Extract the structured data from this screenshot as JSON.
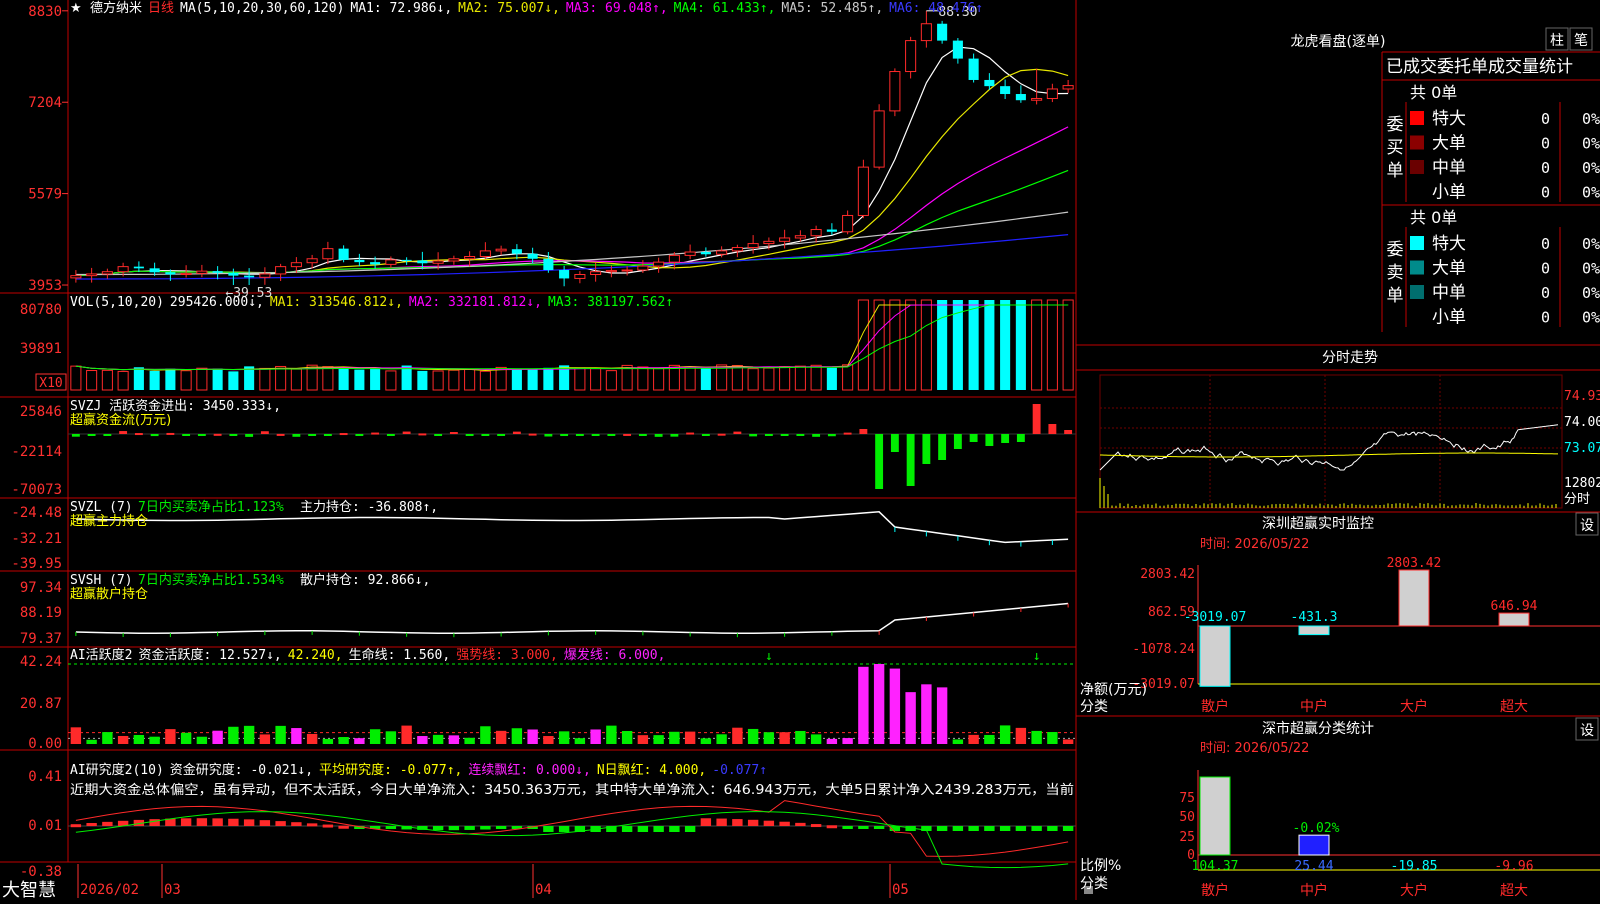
{
  "colors": {
    "up": "#ff2a2a",
    "down": "#00ffff",
    "ma1": "#ffffff",
    "ma2": "#e8e800",
    "ma3": "#ff00ff",
    "ma4": "#00ff00",
    "ma5": "#c8c8c8",
    "ma6": "#2020ff",
    "grid": "#c00000",
    "axis": "#ff3030",
    "green": "#00ee00",
    "magenta": "#ff22ff",
    "yellow": "#ffff00",
    "cyan": "#00ffff",
    "white": "#ffffff",
    "panelTitle": "#e0e0e0"
  },
  "header": {
    "stock": "德方纳米",
    "period": "日线",
    "ma_label": "MA(5,10,20,30,60,120)",
    "ma1": "MA1: 72.986↓,",
    "ma2": "MA2: 75.007↓,",
    "ma3": "MA3: 69.048↑,",
    "ma4": "MA4: 61.433↑,",
    "ma5": "MA5: 52.485↑,",
    "ma6": "MA6: 48.476↑"
  },
  "price_axis": [
    "8830",
    "7204",
    "5579",
    "3953"
  ],
  "price_annotations": {
    "high": "88.30",
    "low": "←39.53"
  },
  "vol": {
    "title": "VOL(5,10,20)",
    "vol": "295426.000↓,",
    "ma1": "MA1: 313546.812↓,",
    "ma2": "MA2: 332181.812↓,",
    "ma3": "MA3: 381197.562↑",
    "axis": [
      "80780",
      "39891"
    ],
    "unit": "X10"
  },
  "svzj": {
    "title": "SVZJ  活跃资金进出: 3450.333↓,",
    "subtitle": "超赢资金流(万元)",
    "axis": [
      "25846",
      "-22114",
      "-70073"
    ]
  },
  "svzl": {
    "title": "SVZL (7)",
    "t2": "7日内买卖净占比1.123%",
    "t3": "主力持仓: -36.808↑,",
    "subtitle": "超赢主力持仓",
    "axis": [
      "-24.48",
      "-32.21",
      "-39.95"
    ]
  },
  "svsh": {
    "title": "SVSH (7)",
    "t2": "7日内买卖净占比1.534%",
    "t3": "散户持仓: 92.866↓,",
    "subtitle": "超赢散户持仓",
    "axis": [
      "97.34",
      "88.19",
      "79.37"
    ]
  },
  "ai1": {
    "t1": "AI活跃度2",
    "t2": "资金活跃度: 12.527↓,",
    "t3": "42.240,",
    "t4": "生命线: 1.560,",
    "t5": "强势线: 3.000,",
    "t6": "爆发线: 6.000,",
    "axis": [
      "42.24",
      "20.87",
      "0.00"
    ]
  },
  "ai2": {
    "t1": "AI研究度2(10)",
    "t2": "资金研究度: -0.021↓,",
    "t3": "平均研究度: -0.077↑,",
    "t4": "连续飘红: 0.000↓,",
    "t5": "N日飘红: 4.000,",
    "t6": "-0.077↑",
    "desc": "近期大资金总体偏空，虽有异动，但不太活跃，今日大单净流入：3450.363万元，其中特大单净流入：646.943万元，大单5日累计净入2439.283万元，当前",
    "axis": [
      "0.41",
      "0.01",
      "-0.38"
    ]
  },
  "bottom": {
    "brand": "大智慧",
    "d1": "2026/02",
    "d2": "03",
    "d3": "04",
    "d4": "05"
  },
  "lhb": {
    "title": "龙虎看盘(逐单)",
    "btn1": "柱",
    "btn2": "笔",
    "tabs": "已成交委托单成交量统计",
    "buy": {
      "label": "委买单",
      "total": "共 0单",
      "rows": [
        {
          "name": "特大",
          "v": "0",
          "p": "0%",
          "c": "#ff0000"
        },
        {
          "name": "大单",
          "v": "0",
          "p": "0%",
          "c": "#8b0000"
        },
        {
          "name": "中单",
          "v": "0",
          "p": "0%",
          "c": "#6a0000"
        },
        {
          "name": "小单",
          "v": "0",
          "p": "0%",
          "c": "#000000"
        }
      ]
    },
    "sell": {
      "label": "委卖单",
      "total": "共 0单",
      "rows": [
        {
          "name": "特大",
          "v": "0",
          "p": "0%",
          "c": "#00ffff"
        },
        {
          "name": "大单",
          "v": "0",
          "p": "0%",
          "c": "#008b8b"
        },
        {
          "name": "中单",
          "v": "0",
          "p": "0%",
          "c": "#006e6e"
        },
        {
          "name": "小单",
          "v": "0",
          "p": "0%",
          "c": "#000000"
        }
      ]
    }
  },
  "intraday": {
    "title": "分时走势",
    "axis": [
      "74.93",
      "74.00",
      "73.07"
    ],
    "vol": "12802",
    "unit": "分时"
  },
  "monitor": {
    "title": "深圳超赢实时监控",
    "btn": "设",
    "time": "时间: 2026/05/22",
    "axis": [
      "2803.42",
      "862.59",
      "-1078.24",
      "-3019.07"
    ],
    "net_label": "净额(万元)",
    "cat_label": "分类",
    "cats": [
      "散户",
      "中户",
      "大户",
      "超大"
    ],
    "vals": [
      "-3019.07",
      "-431.3",
      "2803.42",
      "646.94"
    ]
  },
  "stats": {
    "title": "深市超赢分类统计",
    "btn": "设",
    "time": "时间: 2026/05/22",
    "axis": [
      "75",
      "50",
      "25",
      "0"
    ],
    "ratio_label": "比例%",
    "cat_label": "分类",
    "cats": [
      "散户",
      "中户",
      "大户",
      "超大"
    ],
    "vals": [
      "104.37",
      "25.44",
      "-19.85",
      "-9.96"
    ],
    "note": "-0.02%"
  }
}
